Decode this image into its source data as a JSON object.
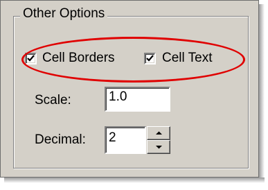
{
  "group": {
    "title": "Other Options"
  },
  "options": {
    "cell_borders": {
      "label": "Cell Borders",
      "checked": true
    },
    "cell_text": {
      "label": "Cell Text",
      "checked": true
    }
  },
  "scale": {
    "label": "Scale:",
    "value": "1.0"
  },
  "decimal": {
    "label": "Decimal:",
    "value": "2"
  },
  "annotation": {
    "color": "#e00000"
  }
}
